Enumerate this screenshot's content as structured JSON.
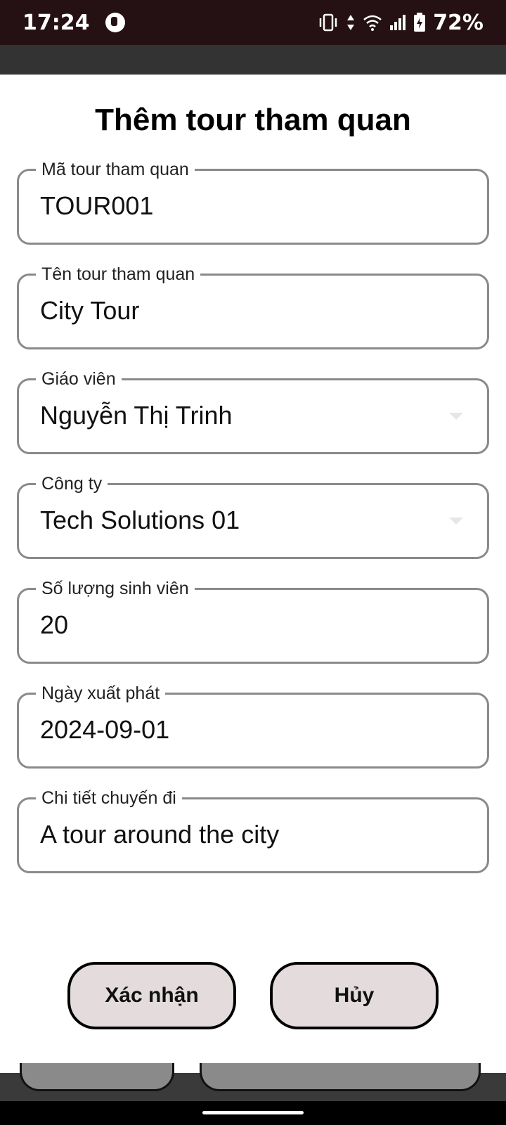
{
  "status_bar": {
    "time": "17:24",
    "battery_percent": "72%",
    "icons": [
      "vibrate-icon",
      "data-arrows-icon",
      "wifi-icon",
      "signal-icon",
      "battery-charging-icon"
    ]
  },
  "dialog": {
    "title": "Thêm tour tham quan",
    "fields": [
      {
        "label": "Mã tour tham quan",
        "value": "TOUR001",
        "type": "text"
      },
      {
        "label": "Tên tour tham quan",
        "value": "City Tour",
        "type": "text"
      },
      {
        "label": "Giáo viên",
        "value": "Nguyễn Thị Trinh",
        "type": "dropdown"
      },
      {
        "label": "Công ty",
        "value": "Tech Solutions 01",
        "type": "dropdown"
      },
      {
        "label": "Số lượng sinh viên",
        "value": "20",
        "type": "text"
      },
      {
        "label": "Ngày xuất phát",
        "value": "2024-09-01",
        "type": "text"
      },
      {
        "label": "Chi tiết chuyến đi",
        "value": "A tour around the city",
        "type": "text"
      }
    ],
    "confirm_label": "Xác nhận",
    "cancel_label": "Hủy"
  },
  "colors": {
    "status_bar_bg": "#251113",
    "button_bg": "#e4dcdc",
    "field_border": "#8a8a8a"
  }
}
